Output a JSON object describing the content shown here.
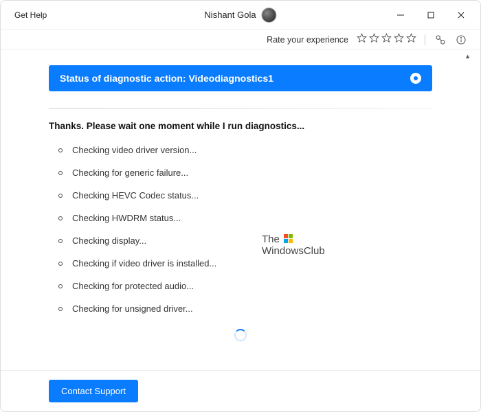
{
  "window": {
    "title": "Get Help",
    "user_name": "Nishant Gola"
  },
  "ratebar": {
    "label": "Rate your experience"
  },
  "status_banner": "Status of diagnostic action: Videodiagnostics1",
  "wait_message": "Thanks. Please wait one moment while I run diagnostics...",
  "checks": [
    "Checking video driver version...",
    "Checking for generic failure...",
    "Checking HEVC Codec status...",
    "Checking HWDRM status...",
    "Checking display...",
    "Checking if video driver is installed...",
    "Checking for protected audio...",
    "Checking for unsigned driver..."
  ],
  "footer": {
    "contact_support": "Contact Support"
  },
  "watermark": {
    "line1": "The",
    "line2": "WindowsClub"
  }
}
